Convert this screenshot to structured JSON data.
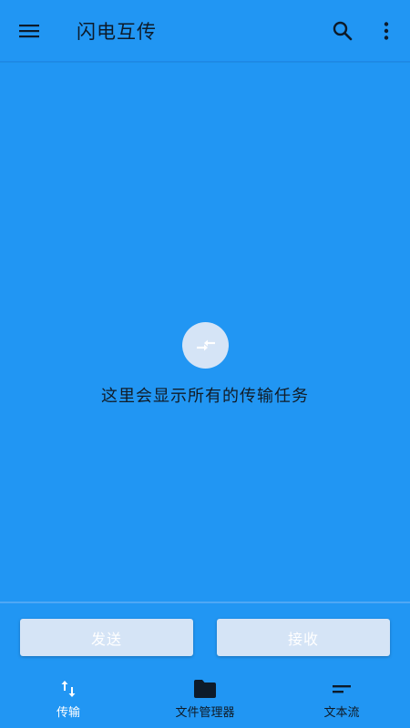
{
  "app": {
    "title": "闪电互传",
    "background_color": "#2196F3"
  },
  "appbar": {
    "menu_icon": "menu-icon",
    "search_icon": "search-icon",
    "more_icon": "more-vertical-icon"
  },
  "empty_state": {
    "icon": "swap-horizontal-icon",
    "message": "这里会显示所有的传输任务"
  },
  "actions": {
    "send_label": "发送",
    "receive_label": "接收"
  },
  "bottom_nav": {
    "items": [
      {
        "label": "传输",
        "icon": "swap-vertical-icon",
        "active": true
      },
      {
        "label": "文件管理器",
        "icon": "folder-icon",
        "active": false
      },
      {
        "label": "文本流",
        "icon": "short-text-icon",
        "active": false
      }
    ]
  }
}
